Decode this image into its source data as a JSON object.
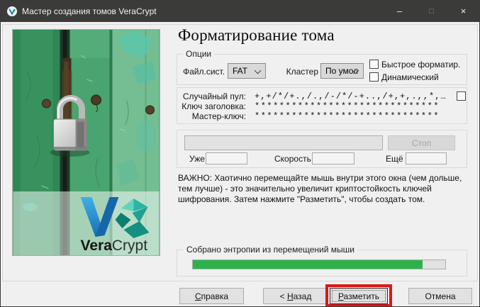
{
  "window": {
    "title": "Мастер создания томов VeraCrypt",
    "minimize_glyph": "–",
    "maximize_glyph": "□",
    "close_glyph": "×"
  },
  "sidebar": {
    "logo_bold": "Vera",
    "logo_light": "Crypt"
  },
  "main": {
    "heading": "Форматирование тома",
    "options": {
      "group_label": "Опции",
      "filesystem_label": "Файл.сист.",
      "filesystem_value": "FAT",
      "cluster_label": "Кластер",
      "cluster_value": "По умол",
      "quick_format_label": "Быстрое форматир.",
      "dynamic_label": "Динамический"
    },
    "random_pool": {
      "pool_label": "Случайный пул:",
      "pool_value": "+,+/*/+.,/.,/-/*/-+..,/+,+,.,,*,…",
      "header_key_label": "Ключ заголовка:",
      "header_key_value": "******************************",
      "master_key_label": "Мастер-ключ:",
      "master_key_value": "******************************"
    },
    "progress": {
      "stop_label": "Стоп",
      "done_label": "Уже",
      "done_value": "",
      "speed_label": "Скорость",
      "speed_value": "",
      "left_label": "Ещё",
      "left_value": ""
    },
    "notice": "ВАЖНО: Хаотично перемещайте мышь внутри этого окна (чем дольше, тем лучше) - это значительно увеличит криптостойкость ключей шифрования. Затем нажмите \"Разметить\", чтобы создать том.",
    "entropy": {
      "group_label": "Собрано энтропии из перемещений мыши",
      "percent": 91
    }
  },
  "footer": {
    "help_accel": "С",
    "help_rest": "правка",
    "back_prefix": "< ",
    "back_accel": "Н",
    "back_rest": "азад",
    "format_accel": "Р",
    "format_rest": "азметить",
    "cancel_label": "Отмена"
  },
  "colors": {
    "titlebar_bg": "#3b3b39",
    "entropy_green": "#2db24b",
    "annotation_red": "#e01515"
  }
}
